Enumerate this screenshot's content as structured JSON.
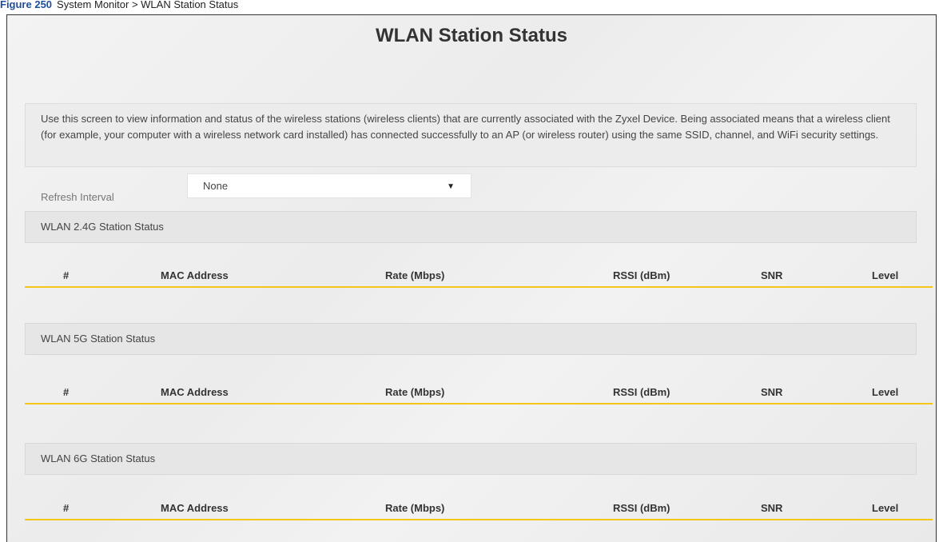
{
  "caption": {
    "figure_label": "Figure 250",
    "text": "System Monitor > WLAN Station Status"
  },
  "page": {
    "title": "WLAN Station Status",
    "description": "Use this screen to view information and status of the wireless stations (wireless clients) that are currently associated with the Zyxel Device. Being associated means that a wireless client (for example, your computer with a wireless network card installed) has connected successfully to an AP (or wireless router) using the same SSID, channel, and WiFi security settings."
  },
  "refresh": {
    "label": "Refresh Interval",
    "value": "None",
    "caret_icon": "caret-down-icon"
  },
  "columns": [
    "#",
    "MAC Address",
    "Rate (Mbps)",
    "RSSI (dBm)",
    "SNR",
    "Level"
  ],
  "sections": [
    {
      "title": "WLAN 2.4G Station Status",
      "rows": []
    },
    {
      "title": "WLAN 5G Station Status",
      "rows": []
    },
    {
      "title": "WLAN 6G Station Status",
      "rows": []
    }
  ],
  "colors": {
    "accent_line": "#f5c518",
    "section_bg": "#e6e6e6",
    "caption_label": "#1f4e9a"
  }
}
